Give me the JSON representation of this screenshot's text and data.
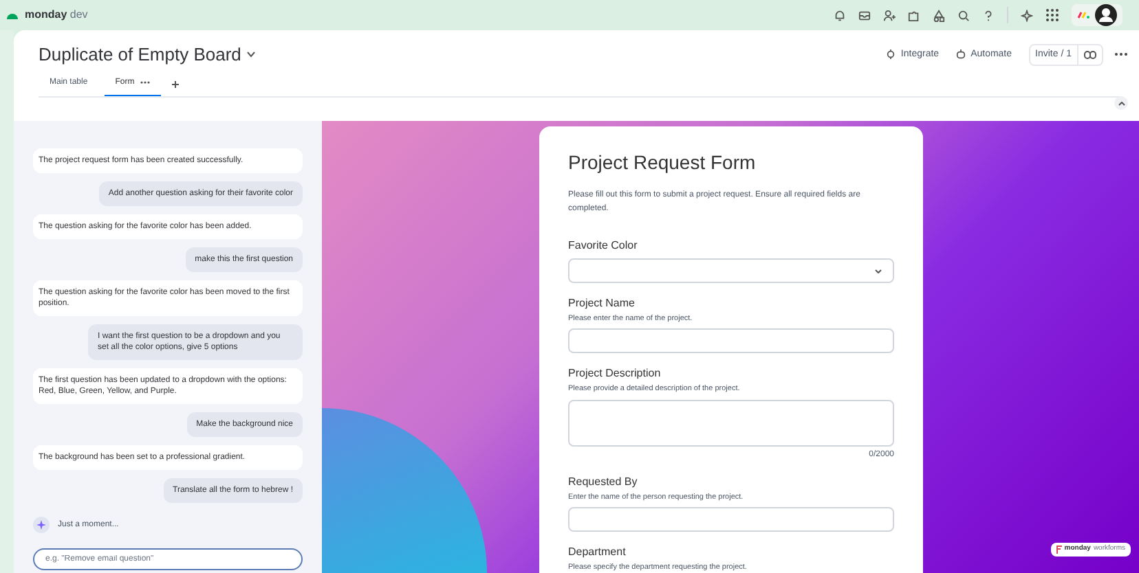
{
  "app": {
    "brand": "monday",
    "product": "dev"
  },
  "board": {
    "title": "Duplicate of Empty Board",
    "tabs": [
      {
        "label": "Main table",
        "selected": false
      },
      {
        "label": "Form",
        "selected": true
      }
    ],
    "actions": [
      "Integrate",
      "Automate"
    ],
    "invite": "Invite / 1"
  },
  "chat": {
    "messages": [
      {
        "kind": "assistant",
        "text": "The project request form has been created successfully."
      },
      {
        "kind": "user",
        "text": "Add another question asking for their favorite color"
      },
      {
        "kind": "assistant",
        "text": "The question asking for the favorite color has been added."
      },
      {
        "kind": "user",
        "text": "make this the first question"
      },
      {
        "kind": "assistant",
        "text": "The question asking for the favorite color has been moved to the first position."
      },
      {
        "kind": "user",
        "text": "I want the first question to be a dropdown and you set all the color options, give 5 options"
      },
      {
        "kind": "assistant",
        "text": "The first question has been updated to a dropdown with the options: Red, Blue, Green, Yellow, and Purple."
      },
      {
        "kind": "user",
        "text": "Make the background nice"
      },
      {
        "kind": "assistant",
        "text": "The background has been set to a professional gradient."
      },
      {
        "kind": "user",
        "text": "Translate all the form to hebrew !"
      }
    ],
    "status": "Just a moment...",
    "input": {
      "placeholder": "e.g. \"Remove email question\""
    }
  },
  "form": {
    "title": "Project Request Form",
    "description": "Please fill out this form to submit a project request. Ensure all required fields are completed.",
    "fields": [
      {
        "kind": "dropdown",
        "label": "Favorite Color"
      },
      {
        "kind": "text",
        "label": "Project Name",
        "hint": "Please enter the name of the project."
      },
      {
        "kind": "textarea",
        "label": "Project Description",
        "hint": "Please provide a detailed description of the project.",
        "counter": "0/2000"
      },
      {
        "kind": "text",
        "label": "Requested By",
        "hint": "Enter the name of the person requesting the project."
      },
      {
        "kind": "text",
        "label": "Department",
        "hint": "Please specify the department requesting the project."
      }
    ]
  },
  "badge": {
    "brand": "monday",
    "product": "workforms"
  }
}
